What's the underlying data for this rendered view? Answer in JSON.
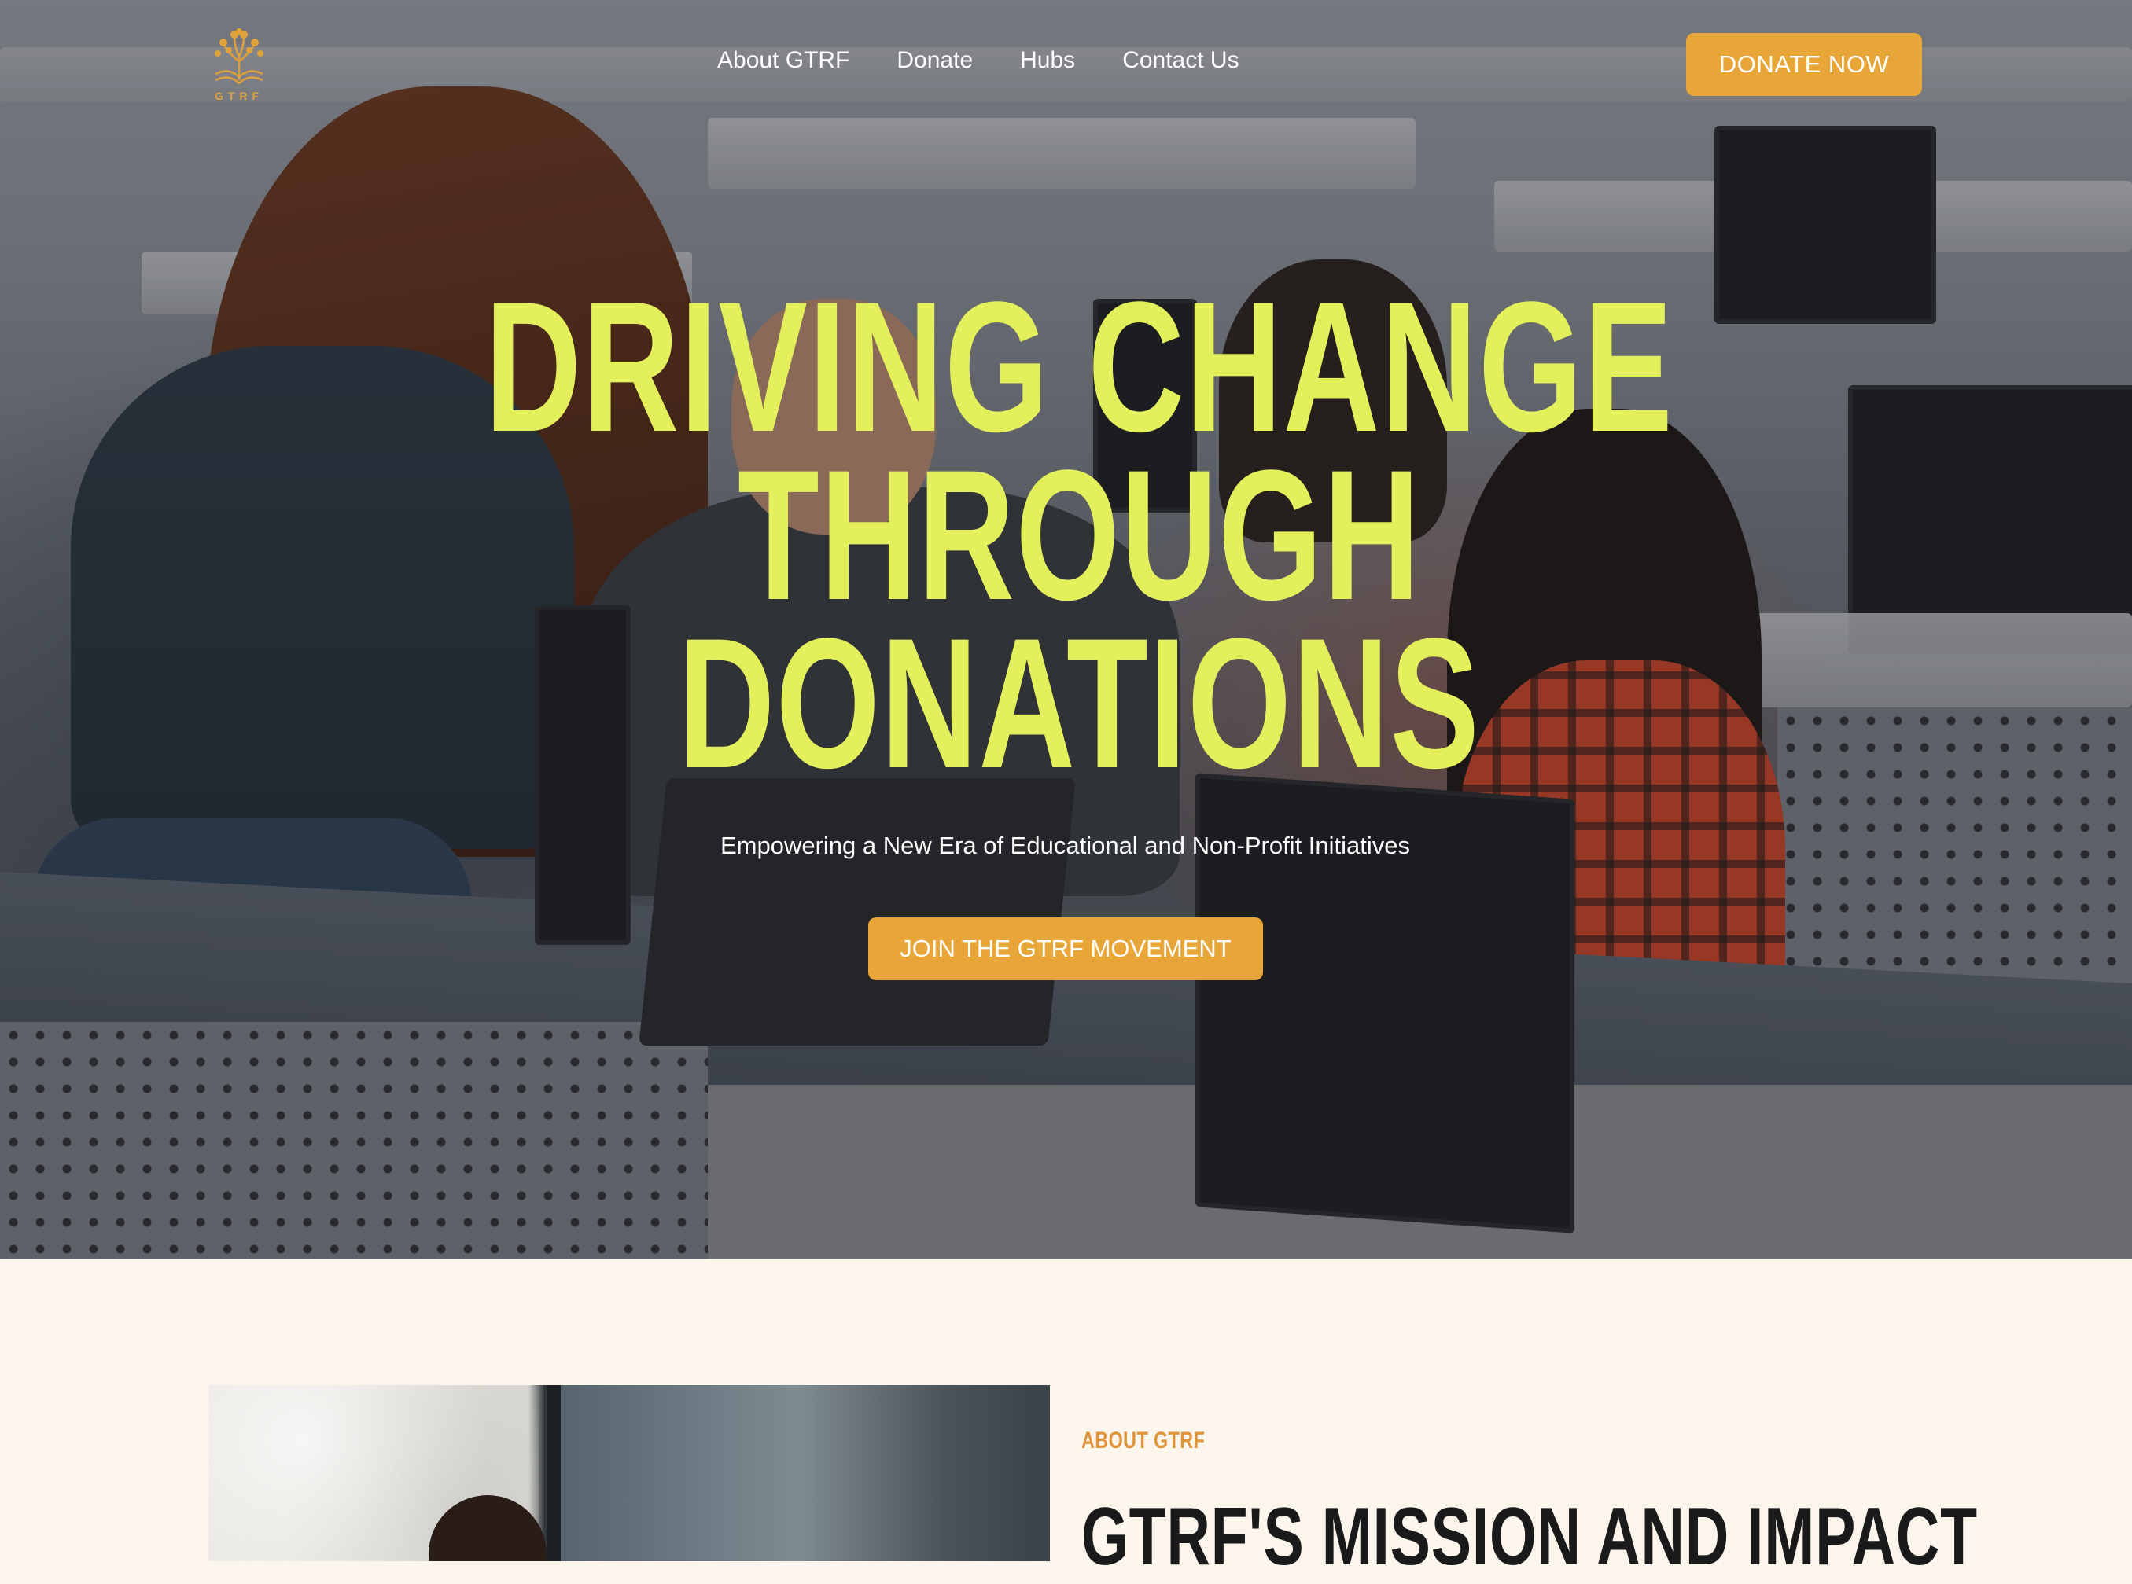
{
  "brand": {
    "logo_text": "GTRF"
  },
  "nav": {
    "items": [
      "About GTRF",
      "Donate",
      "Hubs",
      "Contact Us"
    ],
    "cta_label": "DONATE NOW"
  },
  "hero": {
    "headline_lines": [
      "DRIVING CHANGE",
      "THROUGH",
      "DONATIONS"
    ],
    "subtitle": "Empowering a New Era of Educational and Non-Profit Initiatives",
    "cta_label": "JOIN THE GTRF MOVEMENT",
    "image": "students-at-computer-lab-photo"
  },
  "about": {
    "eyebrow": "ABOUT GTRF",
    "title": "GTRF'S MISSION AND IMPACT",
    "image": "woman-at-desk-photo"
  },
  "colors": {
    "accent": "#e8a638",
    "headline": "#e3f05c",
    "section_bg": "#fcf5ec",
    "eyebrow": "#e0953a"
  }
}
